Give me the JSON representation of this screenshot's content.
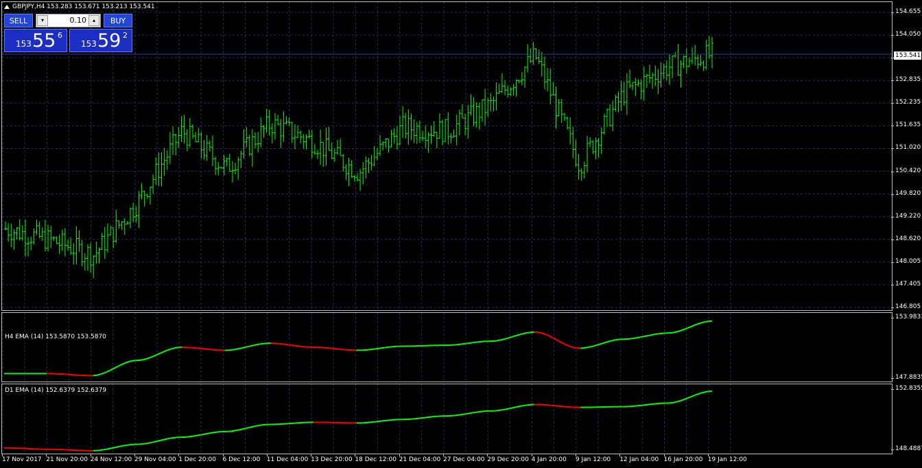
{
  "main_chart": {
    "title": "GBPJPY,H4  153.283 153.671 153.213 153.541",
    "last_price": "153.541",
    "price_ticks": [
      "154.655",
      "154.050",
      "153.435",
      "152.835",
      "152.235",
      "151.635",
      "151.020",
      "150.420",
      "149.820",
      "149.220",
      "148.620",
      "148.005",
      "147.405",
      "146.805"
    ],
    "bar_color": "#00ff00"
  },
  "one_click": {
    "sell_label": "SELL",
    "buy_label": "BUY",
    "lot": "0.10",
    "lot_down_icon": "▾",
    "lot_up_icon": "▴",
    "sell_prefix": "153",
    "sell_big": "55",
    "sell_sup": "6",
    "buy_prefix": "153",
    "buy_big": "59",
    "buy_sup": "2"
  },
  "h4_ema": {
    "title": "H4 EMA (14) 153.5870 153.5870",
    "ticks": [
      "153.9833",
      "147.8835"
    ],
    "up_color": "#00ff00",
    "down_color": "#ff0000"
  },
  "d1_ema": {
    "title": "D1 EMA (14) 152.6379 152.6379",
    "ticks": [
      "152.8355",
      "148.4887"
    ],
    "up_color": "#00ff00",
    "down_color": "#ff0000"
  },
  "time_axis": [
    "17 Nov 2017",
    "21 Nov 20:00",
    "24 Nov 12:00",
    "29 Nov 04:00",
    "1 Dec 20:00",
    "6 Dec 12:00",
    "11 Dec 04:00",
    "13 Dec 20:00",
    "18 Dec 12:00",
    "21 Dec 04:00",
    "27 Dec 04:00",
    "29 Dec 20:00",
    "4 Jan 20:00",
    "9 Jan 12:00",
    "12 Jan 04:00",
    "16 Jan 20:00",
    "19 Jan 12:00"
  ],
  "chart_data": [
    {
      "type": "line",
      "title": "GBPJPY,H4",
      "ylim": [
        146.805,
        154.655
      ],
      "x": [
        "17 Nov 2017",
        "21 Nov 20:00",
        "24 Nov 12:00",
        "29 Nov 04:00",
        "1 Dec 20:00",
        "6 Dec 12:00",
        "11 Dec 04:00",
        "13 Dec 20:00",
        "18 Dec 12:00",
        "21 Dec 04:00",
        "27 Dec 04:00",
        "29 Dec 20:00",
        "4 Jan 20:00",
        "9 Jan 12:00",
        "12 Jan 04:00",
        "16 Jan 20:00",
        "19 Jan 12:00"
      ],
      "series": [
        {
          "name": "GBPJPY,H4",
          "values": [
            148.9,
            148.6,
            148.2,
            149.6,
            151.5,
            150.5,
            151.7,
            151.2,
            150.4,
            151.6,
            151.5,
            152.2,
            153.5,
            150.6,
            152.5,
            153.2,
            153.541
          ]
        }
      ]
    },
    {
      "type": "line",
      "title": "H4 EMA (14)",
      "ylim": [
        147.8835,
        153.9833
      ],
      "x": [
        "17 Nov 2017",
        "21 Nov 20:00",
        "24 Nov 12:00",
        "29 Nov 04:00",
        "1 Dec 20:00",
        "6 Dec 12:00",
        "11 Dec 04:00",
        "13 Dec 20:00",
        "18 Dec 12:00",
        "21 Dec 04:00",
        "27 Dec 04:00",
        "29 Dec 20:00",
        "4 Jan 20:00",
        "9 Jan 12:00",
        "12 Jan 04:00",
        "16 Jan 20:00",
        "19 Jan 12:00"
      ],
      "series": [
        {
          "name": "H4 EMA (14)",
          "values": [
            148.4,
            148.4,
            148.2,
            149.7,
            151.0,
            150.7,
            151.4,
            151.0,
            150.7,
            151.1,
            151.2,
            151.6,
            152.5,
            150.9,
            151.8,
            152.4,
            153.587
          ]
        }
      ]
    },
    {
      "type": "line",
      "title": "D1 EMA (14)",
      "ylim": [
        148.4887,
        152.8355
      ],
      "x": [
        "17 Nov 2017",
        "21 Nov 20:00",
        "24 Nov 12:00",
        "29 Nov 04:00",
        "1 Dec 20:00",
        "6 Dec 12:00",
        "11 Dec 04:00",
        "13 Dec 20:00",
        "18 Dec 12:00",
        "21 Dec 04:00",
        "27 Dec 04:00",
        "29 Dec 20:00",
        "4 Jan 20:00",
        "9 Jan 12:00",
        "12 Jan 04:00",
        "16 Jan 20:00",
        "19 Jan 12:00"
      ],
      "series": [
        {
          "name": "D1 EMA (14)",
          "values": [
            148.65,
            148.55,
            148.45,
            148.9,
            149.4,
            149.8,
            150.3,
            150.45,
            150.4,
            150.65,
            150.9,
            151.25,
            151.7,
            151.5,
            151.55,
            151.8,
            152.638
          ]
        }
      ]
    }
  ]
}
